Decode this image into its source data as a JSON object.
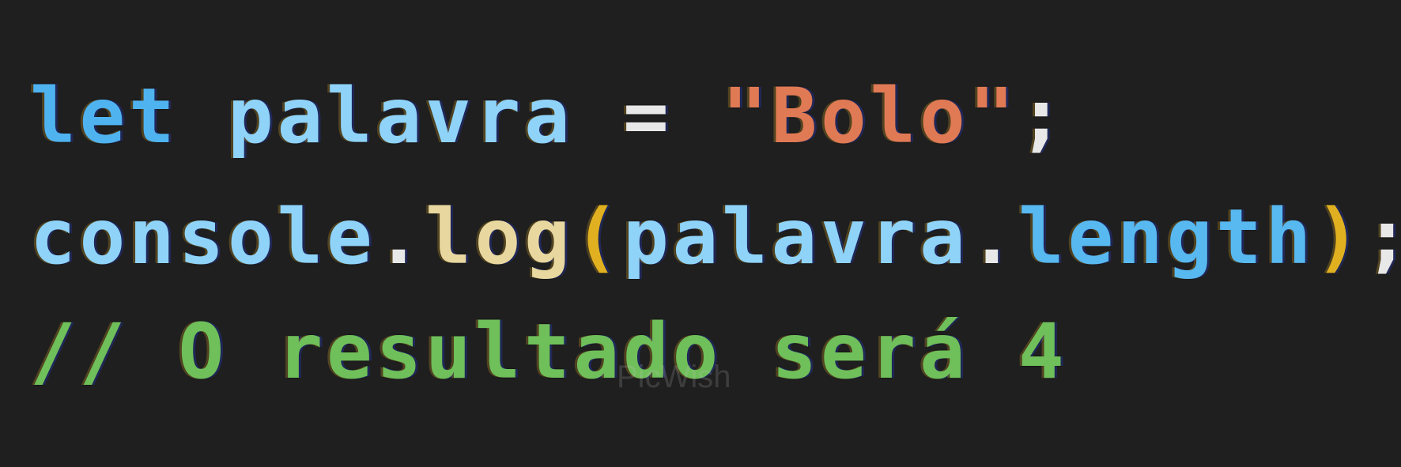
{
  "editor": {
    "line1": {
      "keyword": "let",
      "variable": "palavra",
      "operator": "=",
      "string": "\"Bolo\"",
      "terminator": ";"
    },
    "line2": {
      "object": "console",
      "dot1": ".",
      "method": "log",
      "open_paren": "(",
      "argument": "palavra",
      "dot2": ".",
      "property": "length",
      "close_paren": ")",
      "terminator": ";"
    },
    "line3": {
      "comment": "// O resultado será 4"
    }
  },
  "watermark": "PicWish",
  "colors": {
    "background": "#1f1f1f",
    "keyword": "#4fb3f0",
    "string": "#e07a55",
    "comment": "#6fbf5a",
    "paren": "#e0b020"
  }
}
